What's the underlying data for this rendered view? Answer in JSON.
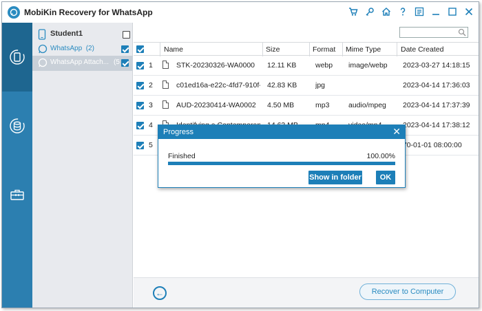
{
  "app": {
    "title": "MobiKin Recovery for WhatsApp"
  },
  "titlebar_icons": [
    {
      "name": "cart-icon",
      "glyph": "🛒"
    },
    {
      "name": "key-icon",
      "glyph": "⚷"
    },
    {
      "name": "home-icon",
      "glyph": "⌂"
    },
    {
      "name": "help-icon",
      "glyph": "?"
    },
    {
      "name": "feedback-icon",
      "glyph": "▤"
    },
    {
      "name": "minimize-icon",
      "glyph": "—"
    },
    {
      "name": "maximize-icon",
      "glyph": "☐"
    },
    {
      "name": "close-icon",
      "glyph": "✕"
    }
  ],
  "tree": {
    "device": "Student1",
    "items": [
      {
        "label": "WhatsApp",
        "count": "(2)"
      },
      {
        "label": "WhatsApp Attach...",
        "count": "(5"
      }
    ]
  },
  "table": {
    "headers": [
      "Name",
      "Size",
      "Format",
      "Mime Type",
      "Date Created"
    ],
    "rows": [
      {
        "index": "1",
        "name": "STK-20230326-WA0000",
        "size": "12.11 KB",
        "format": "webp",
        "mime": "image/webp",
        "date": "2023-03-27 14:18:15"
      },
      {
        "index": "2",
        "name": "c01ed16a-e22c-4fd7-910f-a...",
        "size": "42.83 KB",
        "format": "jpg",
        "mime": "",
        "date": "2023-04-14 17:36:03"
      },
      {
        "index": "3",
        "name": "AUD-20230414-WA0002",
        "size": "4.50 MB",
        "format": "mp3",
        "mime": "audio/mpeg",
        "date": "2023-04-14 17:37:39"
      },
      {
        "index": "4",
        "name": "Identifying a Contemporary ...",
        "size": "14.63 MB",
        "format": "mp4",
        "mime": "video/mp4",
        "date": "2023-04-14 17:38:12"
      },
      {
        "index": "5",
        "name": "",
        "size": "",
        "format": "",
        "mime": "",
        "date": "970-01-01 08:00:00"
      }
    ]
  },
  "bottom": {
    "recover_label": "Recover to Computer",
    "back_glyph": "←"
  },
  "dialog": {
    "title": "Progress",
    "close_glyph": "✕",
    "status": "Finished",
    "percent": "100.00%",
    "progress_fraction": 1.0,
    "show_folder_label": "Show in folder",
    "ok_label": "OK"
  },
  "colors": {
    "accent": "#1d7fb8",
    "nav": "#2c7fb0",
    "nav_active": "#1e6690"
  }
}
